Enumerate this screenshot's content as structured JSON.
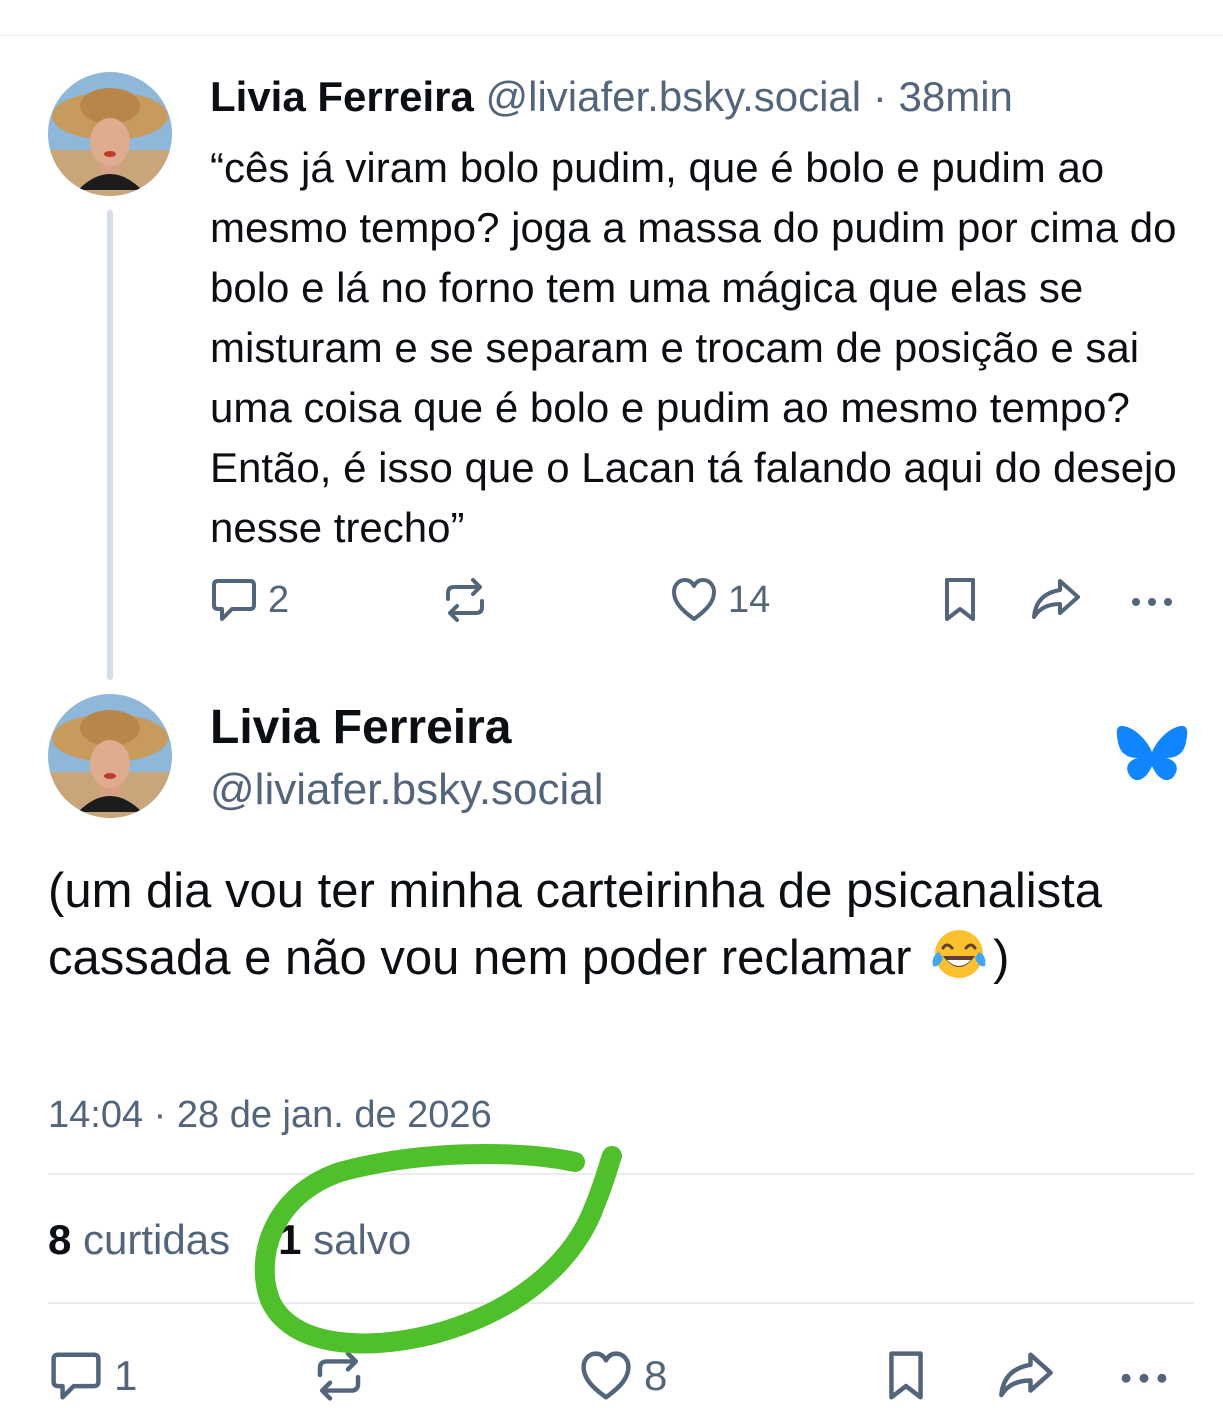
{
  "colors": {
    "accent": "#1185fe",
    "muted": "#53657a",
    "text": "#0b0f14",
    "annotation": "#4fbf2b"
  },
  "post1": {
    "author_name": "Livia Ferreira",
    "handle": "@liviafer.bsky.social",
    "separator": "·",
    "time": "38min",
    "text": "“cês já viram bolo pudim, que é bolo e pudim ao mesmo tempo? joga a massa do pudim por cima do bolo e lá no forno tem uma mágica que elas se misturam e se separam e trocam de posição e sai uma coisa que é bolo e pudim ao mesmo tempo? Então, é isso que o Lacan tá falando aqui do desejo nesse trecho”",
    "reply_count": "2",
    "like_count": "14"
  },
  "post2": {
    "author_name": "Livia Ferreira",
    "handle": "@liviafer.bsky.social",
    "text_before_emoji": "(um dia vou ter minha carteirinha de psicanalista cassada e não vou nem poder reclamar",
    "emoji_name": "face-with-tears-of-joy-emoji",
    "text_after_emoji": ")",
    "timestamp": "14:04 · 28 de jan. de 2026",
    "likes_count": "8",
    "likes_label": "curtidas",
    "saves_count": "1",
    "saves_label": "salvo",
    "reply_count": "1",
    "like_count": "8"
  },
  "icons": {
    "reply": "speech-bubble-icon",
    "repost": "repost-arrows-icon",
    "like": "heart-icon",
    "bookmark": "bookmark-icon",
    "share": "share-arrow-icon",
    "more": "ellipsis-icon",
    "logo": "bluesky-butterfly-icon"
  }
}
